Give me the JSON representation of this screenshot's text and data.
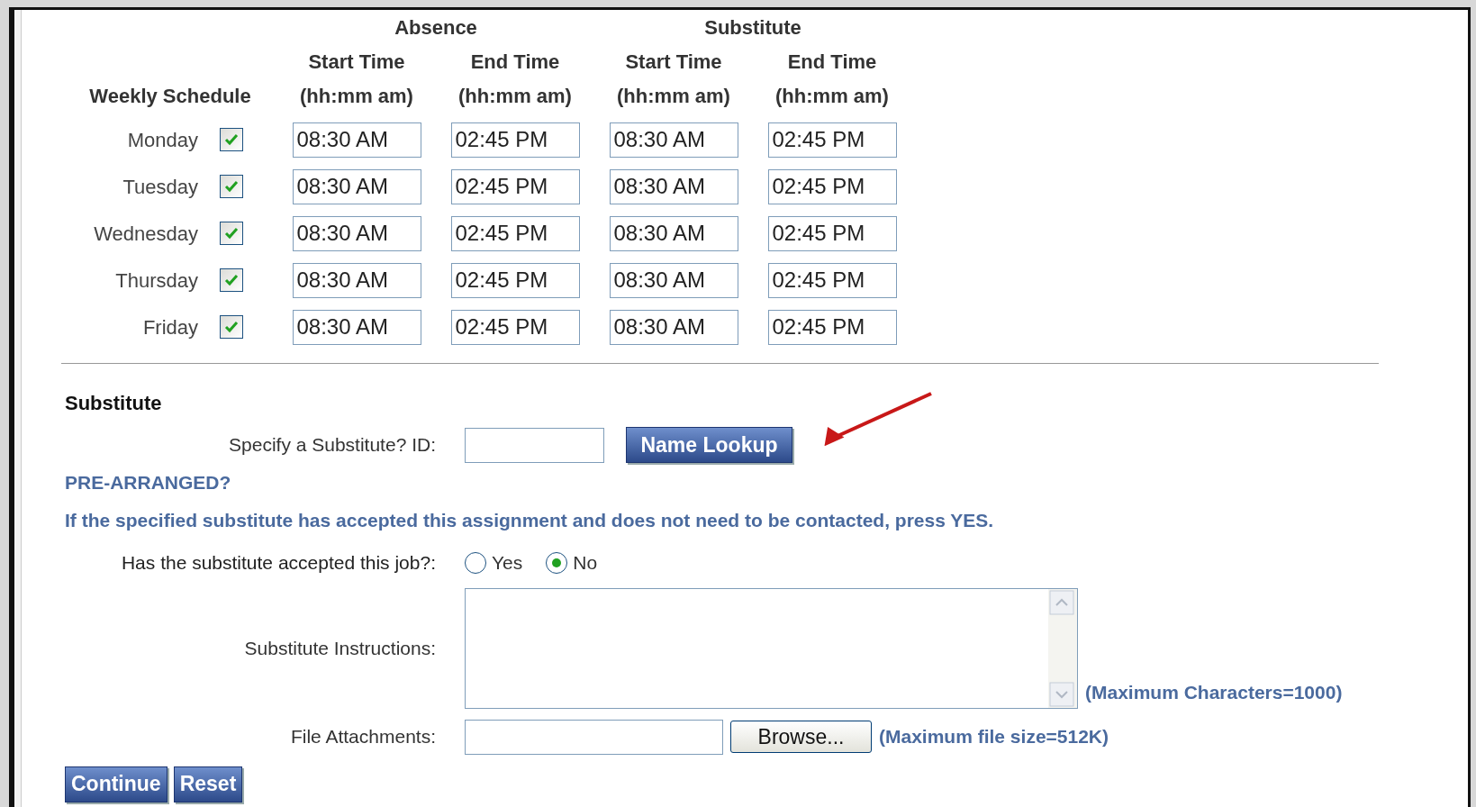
{
  "schedule": {
    "group_headers": [
      "Absence",
      "Substitute"
    ],
    "column_headers": [
      {
        "title": "Start Time",
        "format": "(hh:mm am)"
      },
      {
        "title": "End Time",
        "format": "(hh:mm am)"
      },
      {
        "title": "Start Time",
        "format": "(hh:mm am)"
      },
      {
        "title": "End Time",
        "format": "(hh:mm am)"
      }
    ],
    "label": "Weekly Schedule",
    "days": [
      {
        "name": "Monday",
        "checked": true,
        "times": [
          "08:30 AM",
          "02:45 PM",
          "08:30 AM",
          "02:45 PM"
        ]
      },
      {
        "name": "Tuesday",
        "checked": true,
        "times": [
          "08:30 AM",
          "02:45 PM",
          "08:30 AM",
          "02:45 PM"
        ]
      },
      {
        "name": "Wednesday",
        "checked": true,
        "times": [
          "08:30 AM",
          "02:45 PM",
          "08:30 AM",
          "02:45 PM"
        ]
      },
      {
        "name": "Thursday",
        "checked": true,
        "times": [
          "08:30 AM",
          "02:45 PM",
          "08:30 AM",
          "02:45 PM"
        ]
      },
      {
        "name": "Friday",
        "checked": true,
        "times": [
          "08:30 AM",
          "02:45 PM",
          "08:30 AM",
          "02:45 PM"
        ]
      }
    ]
  },
  "substitute": {
    "heading": "Substitute",
    "id_label": "Specify a Substitute? ID:",
    "lookup_button": "Name Lookup",
    "prearranged_title": "PRE-ARRANGED?",
    "prearranged_note": "If the specified substitute has accepted this assignment and does not need to be contacted, press YES.",
    "accepted_label": "Has the substitute accepted this job?:",
    "accepted_options": [
      {
        "label": "Yes",
        "selected": false
      },
      {
        "label": "No",
        "selected": true
      }
    ],
    "instructions_label": "Substitute Instructions:",
    "instructions_hint": "(Maximum Characters=1000)",
    "attachments_label": "File Attachments:",
    "browse_button": "Browse...",
    "attachments_hint": "(Maximum file size=512K)"
  },
  "actions": [
    "Continue",
    "Reset"
  ]
}
